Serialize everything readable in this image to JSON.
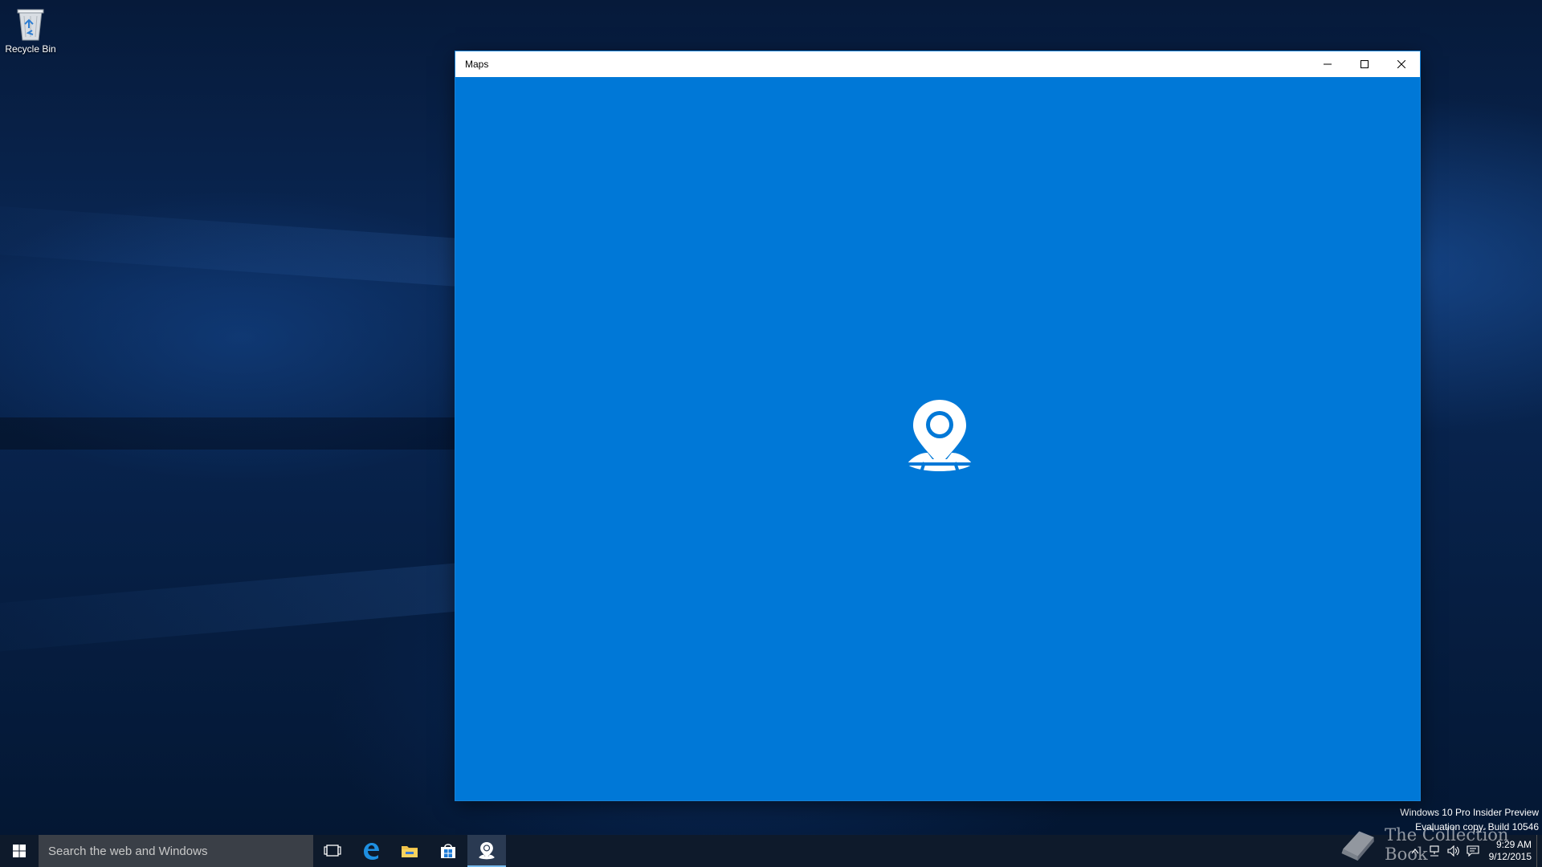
{
  "desktop": {
    "icons": [
      {
        "label": "Recycle Bin",
        "icon": "recycle-bin-icon"
      }
    ]
  },
  "window": {
    "title": "Maps",
    "background_color": "#0078d7",
    "splash_icon": "maps-pin-icon",
    "controls": {
      "minimize": "minimize-icon",
      "maximize": "maximize-icon",
      "close": "close-icon"
    }
  },
  "watermark": {
    "line1": "Windows 10 Pro Insider Preview",
    "line2": "Evaluation copy. Build 10546"
  },
  "taskbar": {
    "search_placeholder": "Search the web and Windows",
    "apps": [
      {
        "name": "task-view",
        "icon": "task-view-icon"
      },
      {
        "name": "edge",
        "icon": "edge-icon"
      },
      {
        "name": "file-explorer",
        "icon": "folder-icon"
      },
      {
        "name": "store",
        "icon": "store-icon"
      },
      {
        "name": "maps",
        "icon": "maps-pin-icon",
        "active": true
      }
    ],
    "clock": {
      "time": "9:29 AM",
      "date": "9/12/2015"
    }
  },
  "overlay": {
    "text": "The Collection Book"
  }
}
